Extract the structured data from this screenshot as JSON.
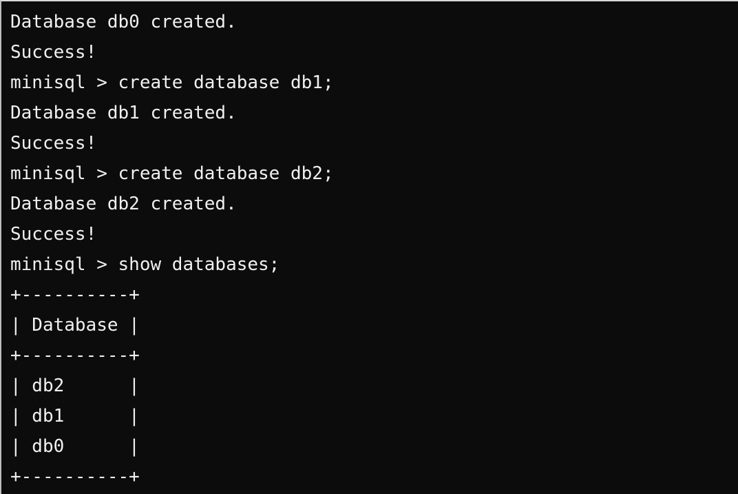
{
  "terminal": {
    "lines": [
      "Database db0 created.",
      "Success!",
      "minisql > create database db1;",
      "Database db1 created.",
      "Success!",
      "minisql > create database db2;",
      "Database db2 created.",
      "Success!",
      "minisql > show databases;",
      "+----------+",
      "| Database |",
      "+----------+",
      "| db2      |",
      "| db1      |",
      "| db0      |",
      "+----------+"
    ]
  },
  "colors": {
    "background": "#0c0c0c",
    "text": "#f0f0f0"
  }
}
